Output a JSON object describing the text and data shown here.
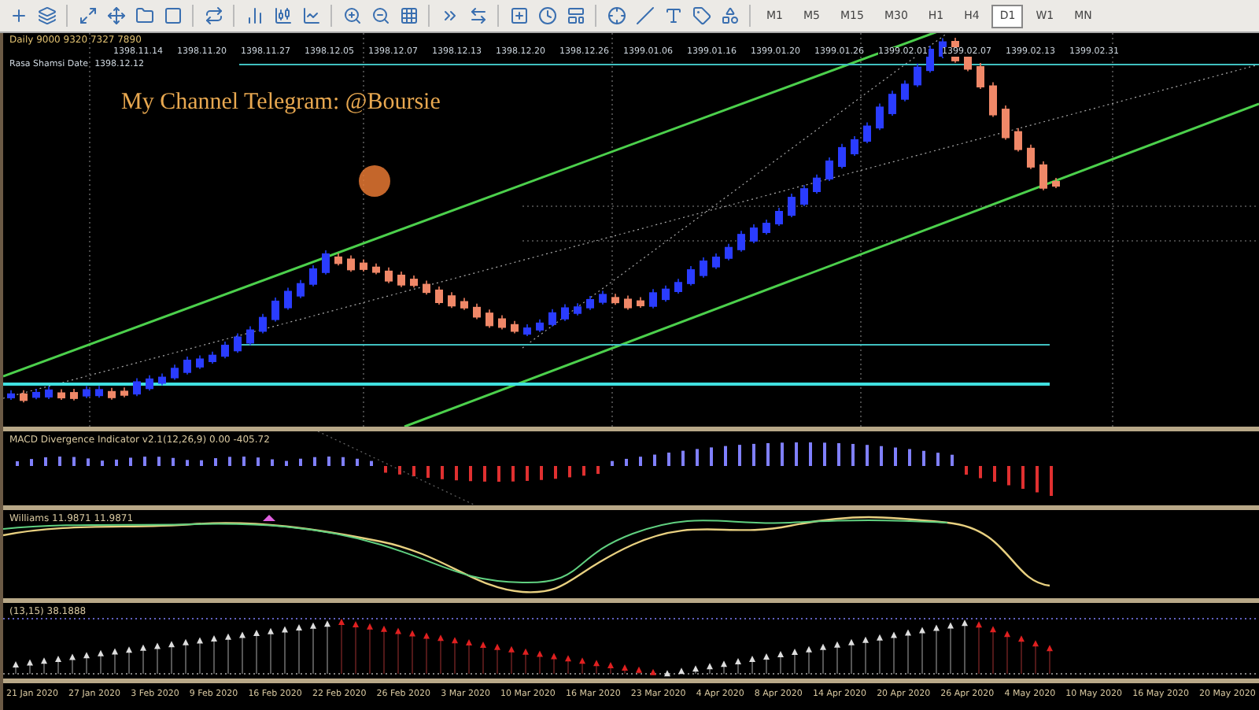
{
  "toolbar": {
    "timeframes": [
      {
        "label": "M1",
        "selected": false
      },
      {
        "label": "M5",
        "selected": false
      },
      {
        "label": "M15",
        "selected": false
      },
      {
        "label": "M30",
        "selected": false
      },
      {
        "label": "H1",
        "selected": false
      },
      {
        "label": "H4",
        "selected": false
      },
      {
        "label": "D1",
        "selected": true
      },
      {
        "label": "W1",
        "selected": false
      },
      {
        "label": "MN",
        "selected": false
      }
    ]
  },
  "chart": {
    "header": "Daily 9000 9320 7327 7890",
    "dates": [
      "1398.11.14",
      "1398.11.20",
      "1398.11.27",
      "1398.12.05",
      "1398.12.07",
      "1398.12.13",
      "1398.12.20",
      "1398.12.26",
      "1399.01.06",
      "1399.01.16",
      "1399.01.20",
      "1399.01.26",
      "1399.02.01",
      "1399.02.07",
      "1399.02.13",
      "1399.02.31"
    ],
    "date_label": "Rasa Shamsi Date",
    "date_value": "1398.12.12",
    "annotation": "My Channel Telegram: @Boursie"
  },
  "macd": {
    "label": "MACD Divergence Indicator v2.1(12,26,9) 0.00 -405.72"
  },
  "williams": {
    "label": "Williams 11.9871 11.9871"
  },
  "oscillator": {
    "label": "(13,15) 38.1888"
  },
  "time_axis": [
    "21 Jan 2020",
    "27 Jan 2020",
    "3 Feb 2020",
    "9 Feb 2020",
    "16 Feb 2020",
    "22 Feb 2020",
    "26 Feb 2020",
    "3 Mar 2020",
    "10 Mar 2020",
    "16 Mar 2020",
    "23 Mar 2020",
    "4 Apr 2020",
    "8 Apr 2020",
    "14 Apr 2020",
    "20 Apr 2020",
    "26 Apr 2020",
    "4 May 2020",
    "10 May 2020",
    "16 May 2020",
    "20 May 2020"
  ]
}
